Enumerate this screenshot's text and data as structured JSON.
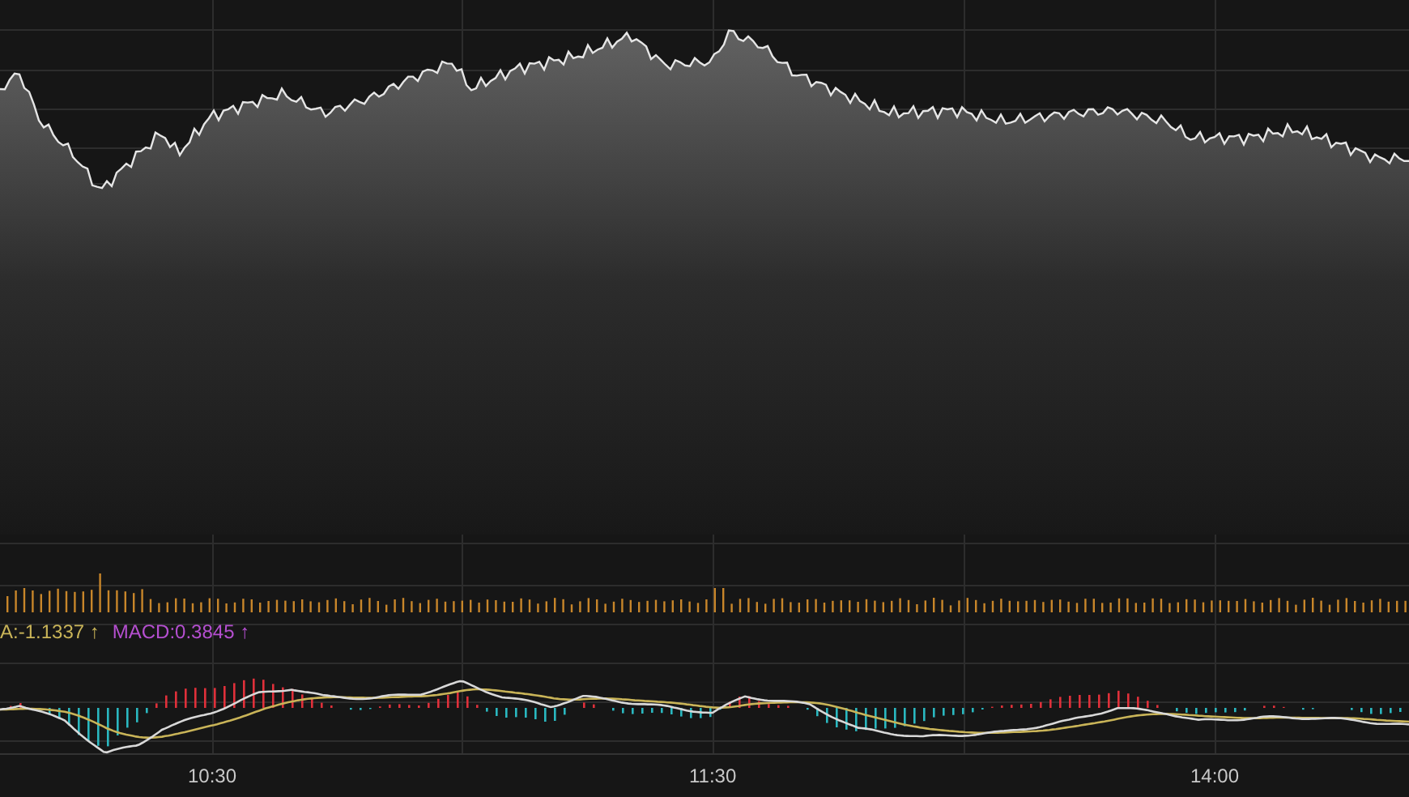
{
  "legend": [
    {
      "text": "A:-1.1337",
      "arrow": "↑",
      "color": "#c9b458"
    },
    {
      "text": "MACD:0.3845",
      "arrow": "↑",
      "color": "#b54fd0"
    }
  ],
  "time_axis": [
    {
      "label": "10:30"
    },
    {
      "label": "11:30"
    },
    {
      "label": "14:00"
    }
  ]
}
